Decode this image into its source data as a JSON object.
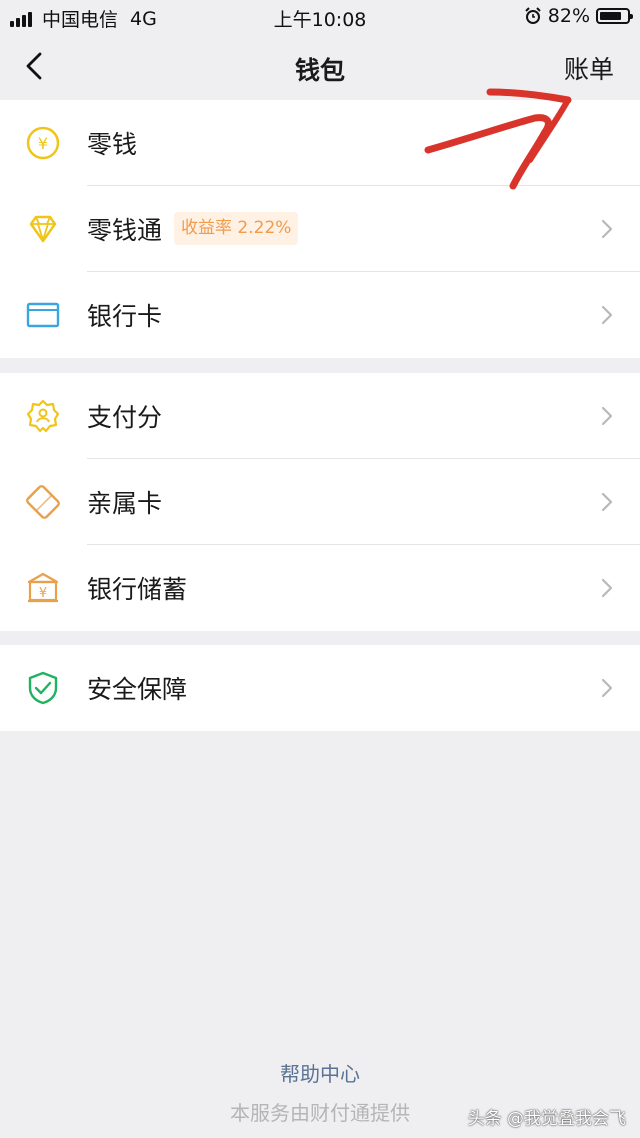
{
  "status_bar": {
    "carrier": "中国电信",
    "network": "4G",
    "time": "上午10:08",
    "battery_text": "82%",
    "battery_level": 0.82
  },
  "nav": {
    "title": "钱包",
    "bill_label": "账单"
  },
  "groups": [
    [
      {
        "label": "零钱",
        "icon": "yuan-coin-icon",
        "chevron": false
      },
      {
        "label": "零钱通",
        "icon": "diamond-icon",
        "badge": "收益率 2.22%",
        "chevron": true
      },
      {
        "label": "银行卡",
        "icon": "bank-card-icon",
        "chevron": true
      }
    ],
    [
      {
        "label": "支付分",
        "icon": "pay-score-icon",
        "chevron": true
      },
      {
        "label": "亲属卡",
        "icon": "family-card-icon",
        "chevron": true
      },
      {
        "label": "银行储蓄",
        "icon": "bank-savings-icon",
        "chevron": true
      }
    ],
    [
      {
        "label": "安全保障",
        "icon": "shield-check-icon",
        "chevron": true
      }
    ]
  ],
  "footer": {
    "help": "帮助中心",
    "provider": "本服务由财付通提供"
  },
  "watermark": "头条 @我觉叠我会飞",
  "colors": {
    "background": "#efeff1",
    "yellow_icon": "#f0c419",
    "blue_icon": "#3aa6e0",
    "orange_icon": "#e9a04c",
    "green_icon": "#1fb35f",
    "badge_text": "#f29b4b",
    "badge_bg": "#fff1e4",
    "link": "#5a7394",
    "annotation_arrow": "#d9342b"
  }
}
